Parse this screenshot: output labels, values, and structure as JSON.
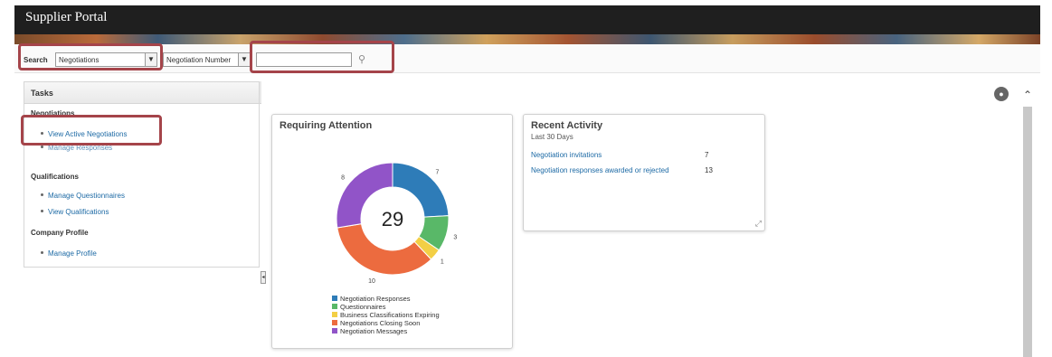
{
  "header": {
    "title": "Supplier Portal"
  },
  "search": {
    "label": "Search",
    "type_value": "Negotiations",
    "field_value": "Negotiation Number",
    "query_value": ""
  },
  "tasks": {
    "title": "Tasks",
    "groups": [
      {
        "title": "Negotiations",
        "items": [
          "View Active Negotiations",
          "Manage Responses"
        ]
      },
      {
        "title": "Qualifications",
        "items": [
          "Manage Questionnaires",
          "View Qualifications"
        ]
      },
      {
        "title": "Company Profile",
        "items": [
          "Manage Profile"
        ]
      }
    ]
  },
  "requiring_attention": {
    "title": "Requiring Attention",
    "total": "29",
    "segments": [
      {
        "label": "Negotiation Responses",
        "value": 7,
        "color": "#2e7cb8"
      },
      {
        "label": "Questionnaires",
        "value": 3,
        "color": "#59b868"
      },
      {
        "label": "Business Classifications Expiring",
        "value": 1,
        "color": "#f3cf45"
      },
      {
        "label": "Negotiations Closing Soon",
        "value": 10,
        "color": "#ec6b3f"
      },
      {
        "label": "Negotiation Messages",
        "value": 8,
        "color": "#9154c8"
      }
    ]
  },
  "recent_activity": {
    "title": "Recent Activity",
    "subtitle": "Last 30 Days",
    "rows": [
      {
        "label": "Negotiation invitations",
        "count": "7"
      },
      {
        "label": "Negotiation responses awarded or rejected",
        "count": "13"
      }
    ]
  }
}
